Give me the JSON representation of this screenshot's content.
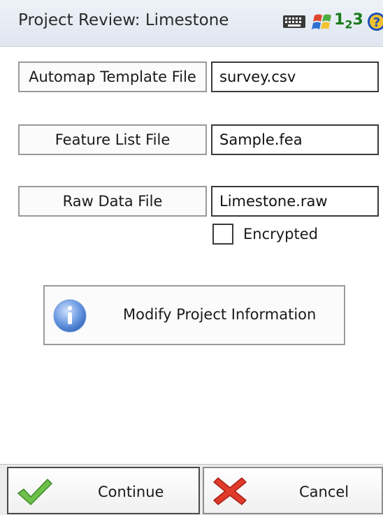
{
  "title_bar": {
    "title": "Project Review: Limestone",
    "input_mode": {
      "main": "1",
      "sub": "2",
      "tail": "3"
    },
    "icons": [
      "keyboard-icon",
      "windows-start-icon",
      "help-icon"
    ]
  },
  "files": {
    "automap": {
      "button_label": "Automap Template File",
      "value": "survey.csv"
    },
    "feature": {
      "button_label": "Feature List File",
      "value": "Sample.fea"
    },
    "raw": {
      "button_label": "Raw Data File",
      "value": "Limestone.raw"
    }
  },
  "encrypted": {
    "label": "Encrypted",
    "checked": false
  },
  "modify": {
    "label": "Modify Project Information",
    "icon": "info-icon"
  },
  "actions": {
    "continue_label": "Continue",
    "continue_icon": "check-icon",
    "cancel_label": "Cancel",
    "cancel_icon": "x-icon"
  },
  "colors": {
    "check_green": "#6cc04a",
    "cancel_red": "#e03a2a",
    "info_blue": "#4f86d6"
  }
}
